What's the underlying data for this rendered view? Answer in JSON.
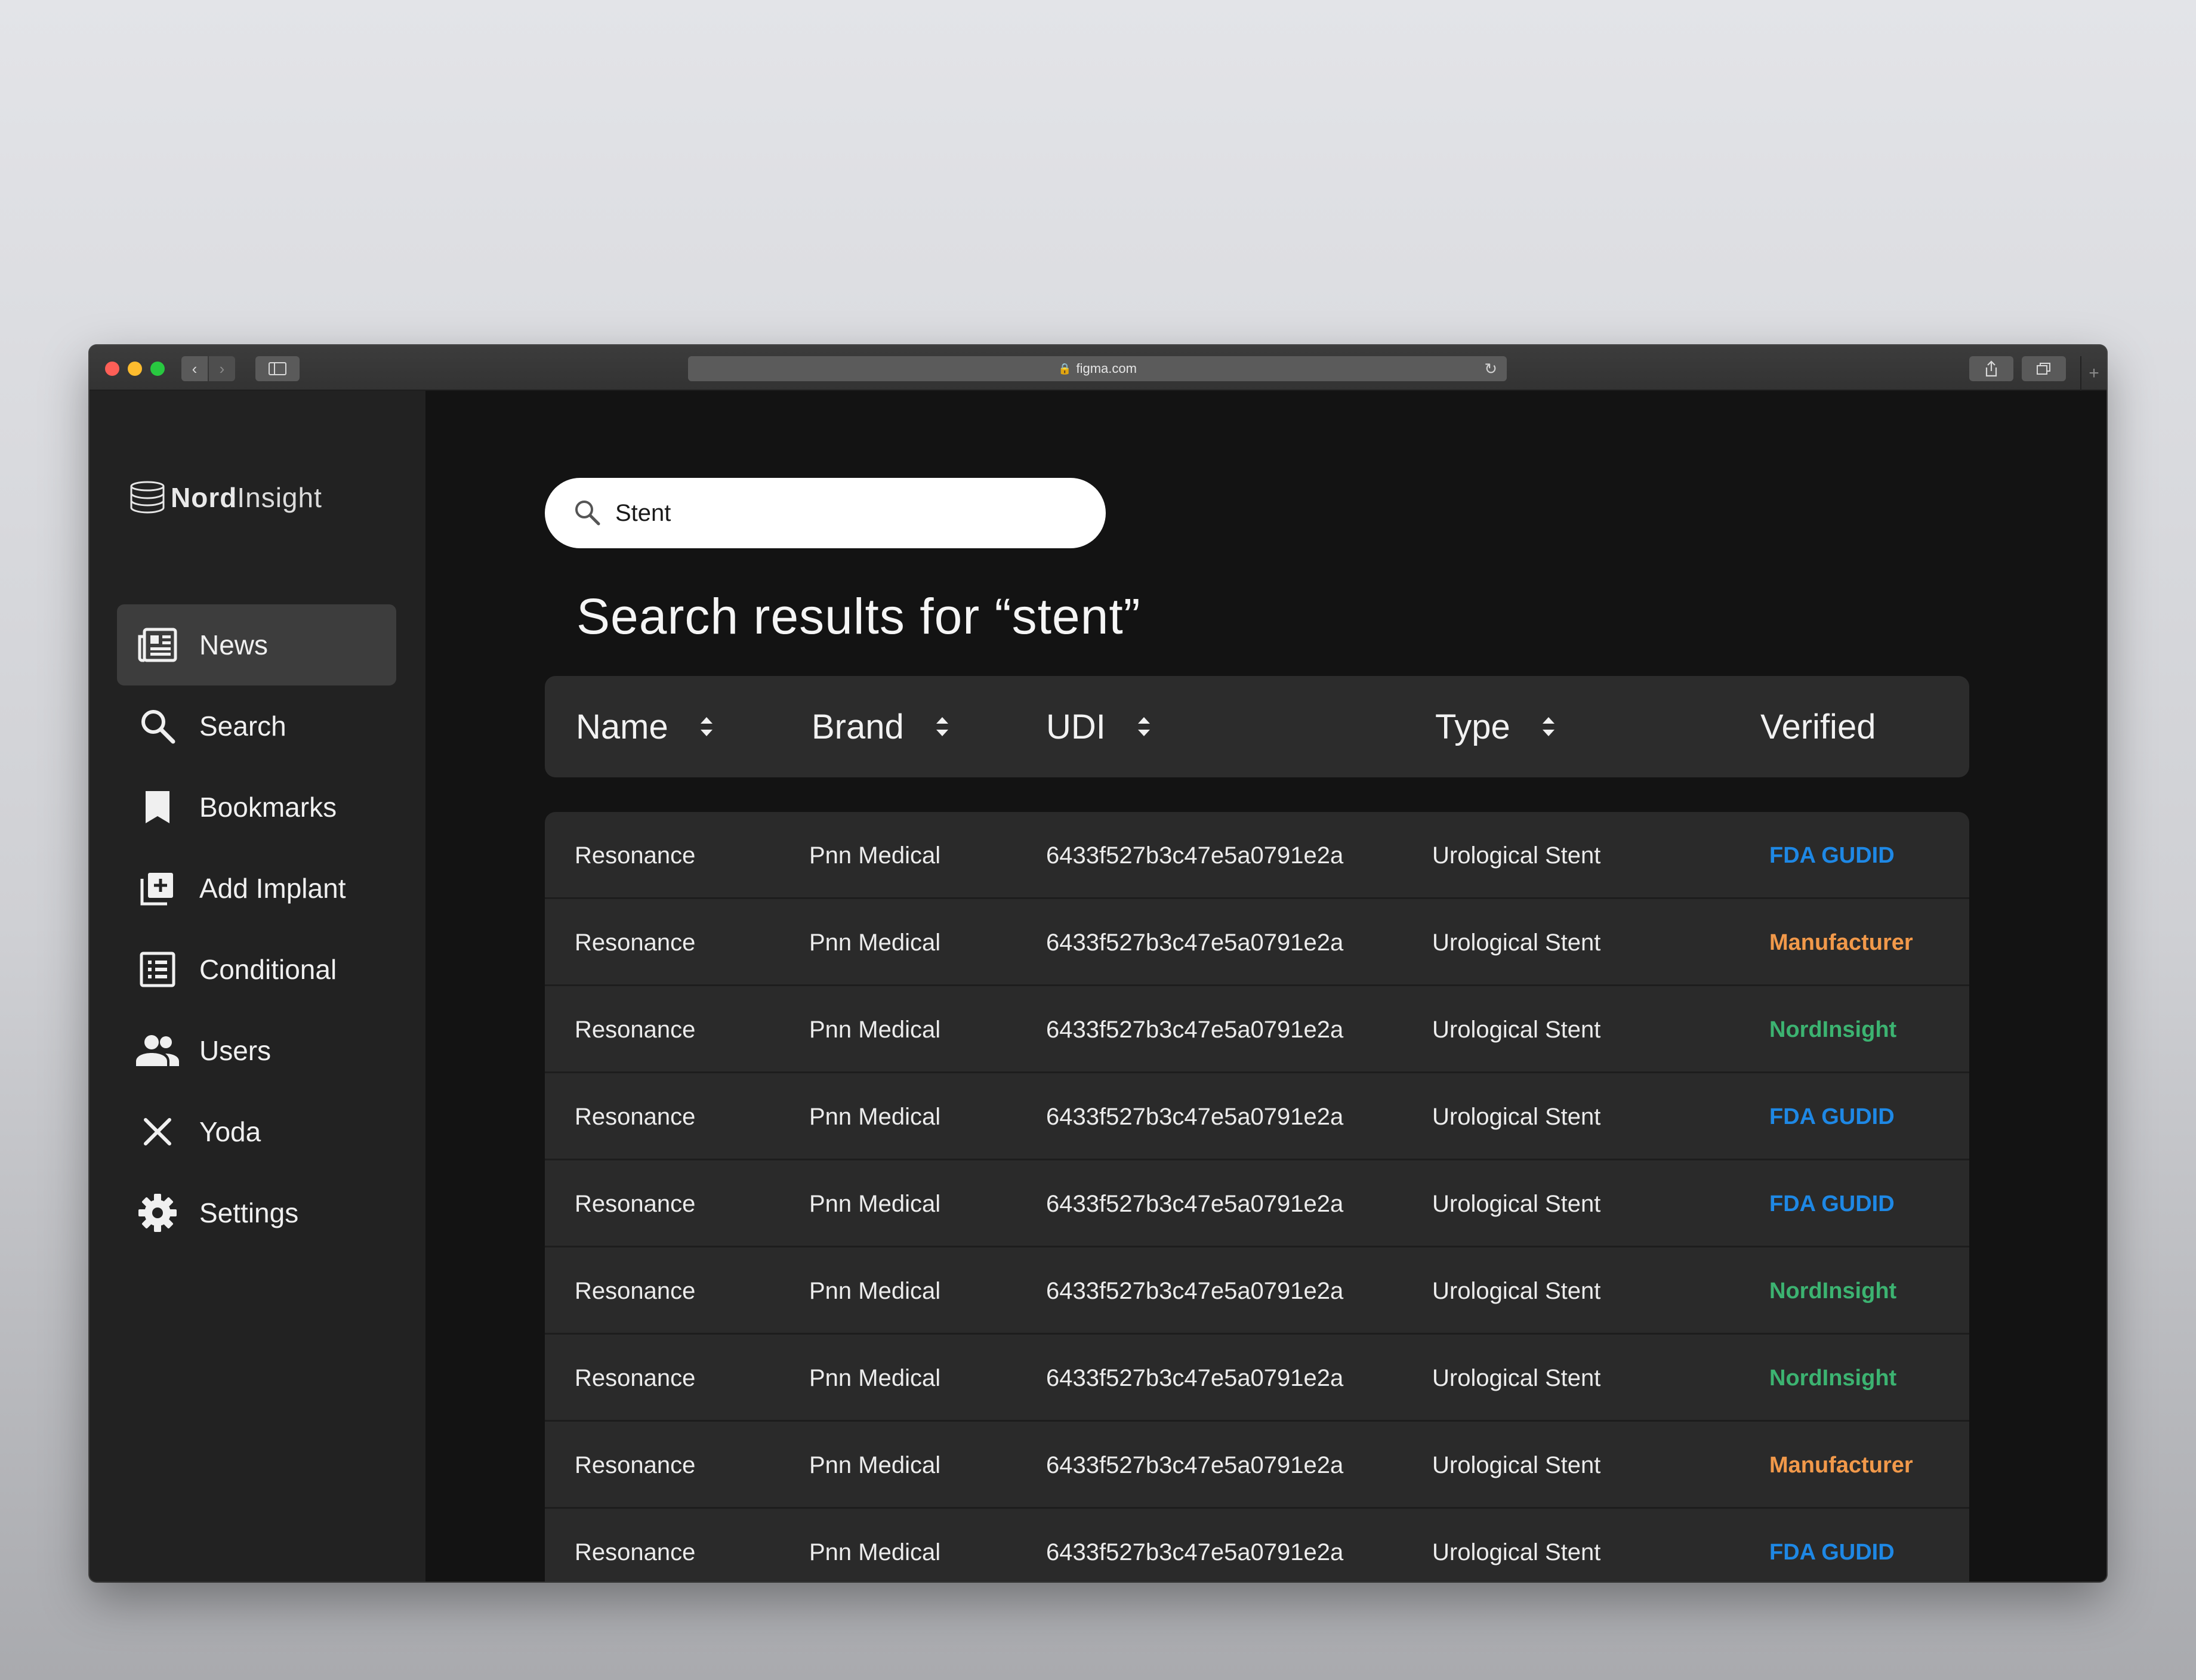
{
  "browser": {
    "url": "figma.com"
  },
  "app": {
    "logo": {
      "bold": "Nord",
      "light": "Insight"
    }
  },
  "sidebar": {
    "items": [
      {
        "label": "News",
        "icon": "news-icon",
        "active": true
      },
      {
        "label": "Search",
        "icon": "search-icon",
        "active": false
      },
      {
        "label": "Bookmarks",
        "icon": "bookmark-icon",
        "active": false
      },
      {
        "label": "Add Implant",
        "icon": "add-box-icon",
        "active": false
      },
      {
        "label": "Conditional",
        "icon": "list-icon",
        "active": false
      },
      {
        "label": "Users",
        "icon": "users-icon",
        "active": false
      },
      {
        "label": "Yoda",
        "icon": "close-icon",
        "active": false
      },
      {
        "label": "Settings",
        "icon": "gear-icon",
        "active": false
      }
    ]
  },
  "search": {
    "value": "Stent"
  },
  "results": {
    "title": "Search results for “stent”"
  },
  "table": {
    "columns": [
      {
        "label": "Name",
        "sortable": true
      },
      {
        "label": "Brand",
        "sortable": true
      },
      {
        "label": "UDI",
        "sortable": true
      },
      {
        "label": "Type",
        "sortable": true
      },
      {
        "label": "Verified",
        "sortable": false
      }
    ],
    "rows": [
      {
        "name": "Resonance",
        "brand": "Pnn Medical",
        "udi": "6433f527b3c47e5a0791e2a",
        "type": "Urological Stent",
        "verified": "FDA GUDID"
      },
      {
        "name": "Resonance",
        "brand": "Pnn Medical",
        "udi": "6433f527b3c47e5a0791e2a",
        "type": "Urological Stent",
        "verified": "Manufacturer"
      },
      {
        "name": "Resonance",
        "brand": "Pnn Medical",
        "udi": "6433f527b3c47e5a0791e2a",
        "type": "Urological Stent",
        "verified": "NordInsight"
      },
      {
        "name": "Resonance",
        "brand": "Pnn Medical",
        "udi": "6433f527b3c47e5a0791e2a",
        "type": "Urological Stent",
        "verified": "FDA GUDID"
      },
      {
        "name": "Resonance",
        "brand": "Pnn Medical",
        "udi": "6433f527b3c47e5a0791e2a",
        "type": "Urological Stent",
        "verified": "FDA GUDID"
      },
      {
        "name": "Resonance",
        "brand": "Pnn Medical",
        "udi": "6433f527b3c47e5a0791e2a",
        "type": "Urological Stent",
        "verified": "NordInsight"
      },
      {
        "name": "Resonance",
        "brand": "Pnn Medical",
        "udi": "6433f527b3c47e5a0791e2a",
        "type": "Urological Stent",
        "verified": "NordInsight"
      },
      {
        "name": "Resonance",
        "brand": "Pnn Medical",
        "udi": "6433f527b3c47e5a0791e2a",
        "type": "Urological Stent",
        "verified": "Manufacturer"
      },
      {
        "name": "Resonance",
        "brand": "Pnn Medical",
        "udi": "6433f527b3c47e5a0791e2a",
        "type": "Urological Stent",
        "verified": "FDA GUDID"
      }
    ]
  },
  "colors": {
    "verified": {
      "FDA GUDID": "#1e88e5",
      "Manufacturer": "#f2994a",
      "NordInsight": "#3cb371"
    },
    "sidebar_bg": "#222222",
    "main_bg": "#131313",
    "table_bg": "#2a2a2a"
  }
}
